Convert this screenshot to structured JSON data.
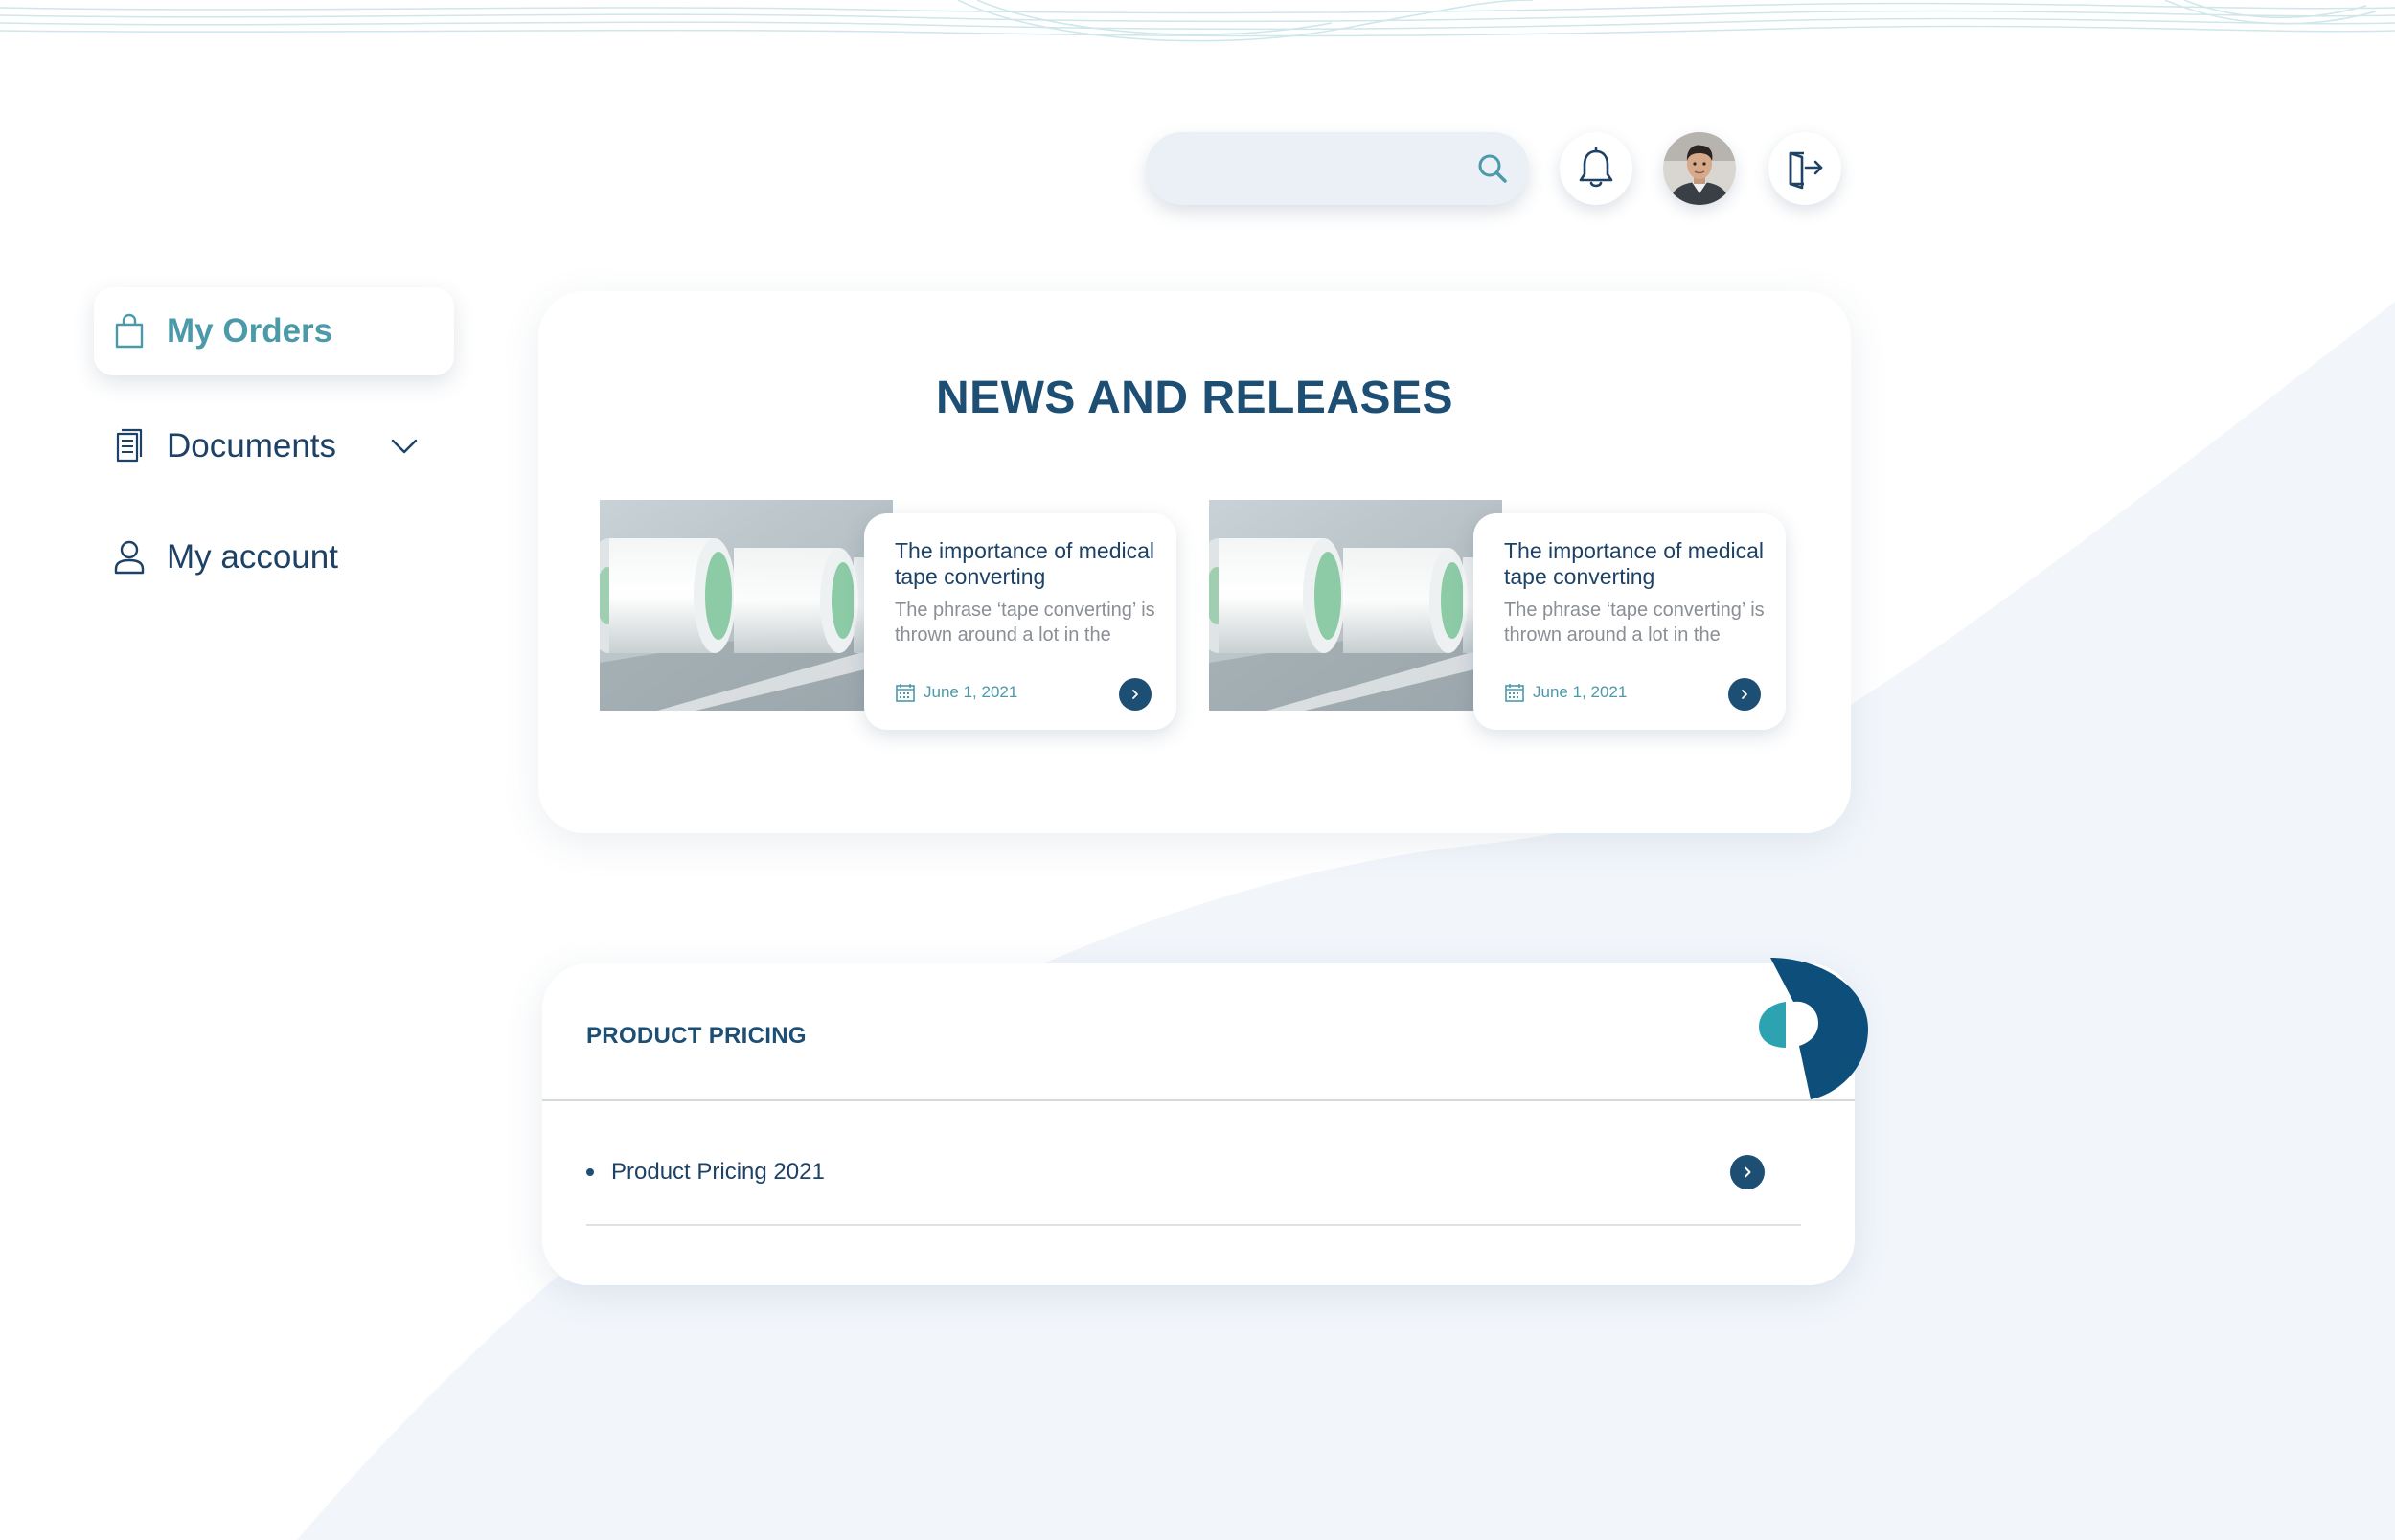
{
  "search": {
    "value": "",
    "placeholder": ""
  },
  "icons": {
    "search": "search-icon",
    "notifications": "bell-icon",
    "avatar": "user-avatar",
    "logout": "logout-icon",
    "orders": "shopping-bag-icon",
    "documents": "documents-icon",
    "documents_toggle": "chevron-down-icon",
    "account": "user-icon",
    "date": "calendar-icon",
    "arrow": "chevron-right-icon"
  },
  "sidebar": {
    "items": [
      {
        "label": "My Orders",
        "active": true
      },
      {
        "label": "Documents",
        "active": false,
        "expandable": true
      },
      {
        "label": "My account",
        "active": false
      }
    ]
  },
  "news": {
    "title": "NEWS AND RELEASES",
    "items": [
      {
        "headline": "The importance of medical tape converting",
        "excerpt": "The phrase ‘tape converting’ is thrown around a lot in the",
        "date": "June 1, 2021"
      },
      {
        "headline": "The importance of medical tape converting",
        "excerpt": "The phrase ‘tape converting’ is thrown around a lot in the",
        "date": "June 1, 2021"
      }
    ]
  },
  "pricing": {
    "title": "PRODUCT PRICING",
    "items": [
      {
        "label": "Product Pricing 2021"
      }
    ]
  },
  "colors": {
    "navy": "#1d4e73",
    "teal": "#4b9aaa",
    "brand_teal": "#2da3b1",
    "brand_navy": "#0e4e7a",
    "background_tint": "#f2f6fb",
    "search_background": "#eaf0f6"
  }
}
